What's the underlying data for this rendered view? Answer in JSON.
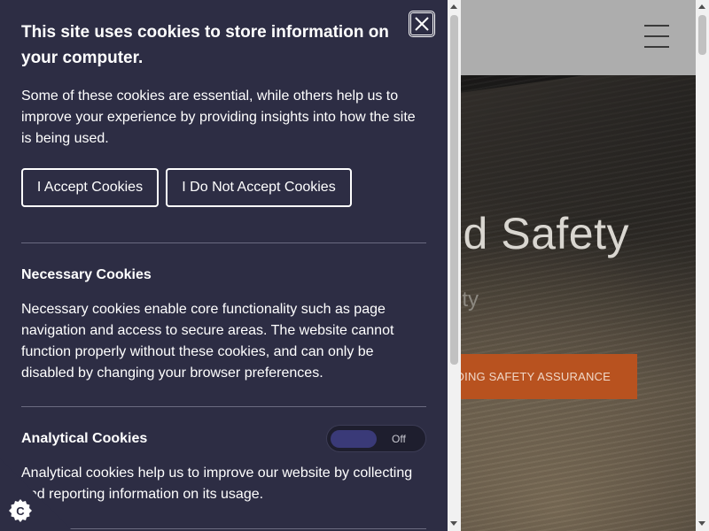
{
  "site": {
    "hero": {
      "title_partial": "nd Safety",
      "subtitle_partial": "ty",
      "cta_partial": "DING SAFETY ASSURANCE"
    },
    "header": {
      "menu_icon": "hamburger-menu-icon"
    }
  },
  "cookie_panel": {
    "title": "This site uses cookies to store information on your computer.",
    "intro": "Some of these cookies are essential, while others help us to improve your experience by providing insights into how the site is being used.",
    "accept_label": "I Accept Cookies",
    "decline_label": "I Do Not Accept Cookies",
    "close_icon": "close-icon",
    "sections": [
      {
        "heading": "Necessary Cookies",
        "text": "Necessary cookies enable core functionality such as page navigation and access to secure areas. The website cannot function properly without these cookies, and can only be disabled by changing your browser preferences."
      },
      {
        "heading": "Analytical Cookies",
        "text": "Analytical cookies help us to improve our website by collecting and reporting information on its usage.",
        "toggle_state": "Off"
      }
    ],
    "badge_icon": "cookie-settings-icon"
  },
  "colors": {
    "panel_bg": "#2d2d44",
    "cta_bg": "#b8521f",
    "toggle_knob": "#3a3a78"
  }
}
